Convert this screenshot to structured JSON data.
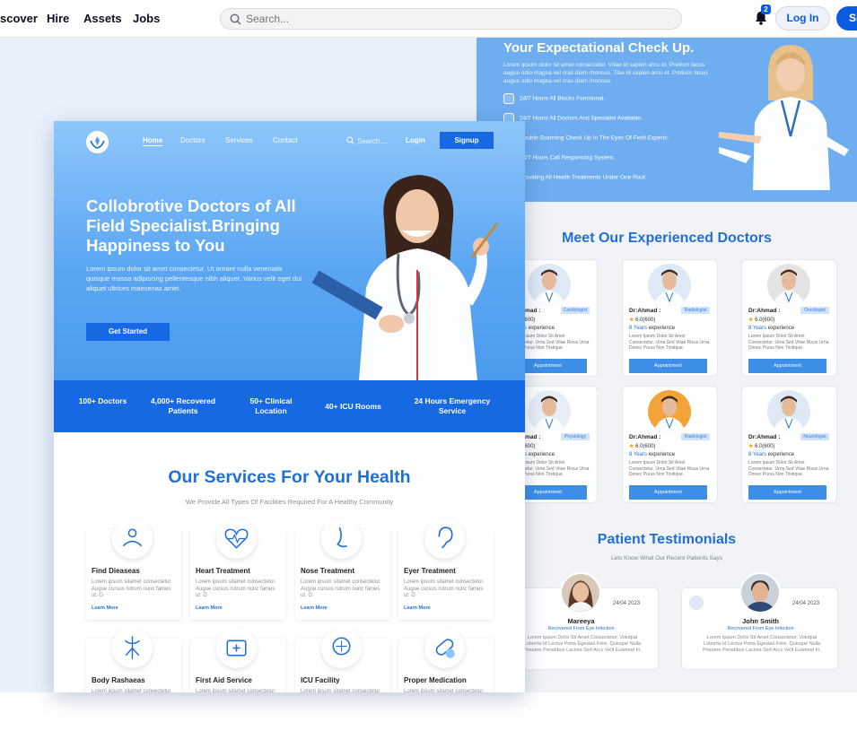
{
  "topnav": {
    "links": [
      "scover",
      "Hire",
      "Assets",
      "Jobs"
    ],
    "search_placeholder": "Search...",
    "notif_count": "2",
    "login": "Log In",
    "signup": "Si"
  },
  "right": {
    "hero_title": "Your Expectational Check Up.",
    "hero_text": "Lorem ipsum dolor sit amet consectetur. Vitae id sapien arcu et. Pretium lacus augue odio magna vel cras diam rhoncus. Tlae id sapien arcu et. Pretium lacus augue odio magna vel cras diam rhoncus.",
    "features": [
      "24/7 Hours All Blocks Functional.",
      "24/7 Hours All Doctors And Specialist Available.",
      "Double Scanning Check Up In The Eyes Of Field Experts.",
      "24/7 Hours Call Responcing System.",
      "Providing All Health Treatments Under One Roof."
    ],
    "doctors_title": "Meet Our Experienced Doctors",
    "doctors": [
      {
        "name": "Dr:Ahmad :",
        "spec": "Cardiologist",
        "rating": "6.0(600)",
        "exp": "8 Years",
        "exp_label": "experience",
        "desc": "Lorem Ipsum Dolor Sit Amet Consectetur. Urna Sed Vitae Risus Urna Donec Purus Non Tristique.",
        "button": "Appointment"
      },
      {
        "name": "Dr:Ahmad :",
        "spec": "Radiologist",
        "rating": "6.0(600)",
        "exp": "8 Years",
        "exp_label": "experience",
        "desc": "Lorem Ipsum Dolor Sit Amet Consectetur. Urna Sed Vitae Risus Urna Donec Purus Non Tristique.",
        "button": "Appointment"
      },
      {
        "name": "Dr:Ahmad :",
        "spec": "Oncologist",
        "rating": "6.0(600)",
        "exp": "8 Years",
        "exp_label": "experience",
        "desc": "Lorem Ipsum Dolor Sit Amet Consectetur. Urna Sed Vitae Risus Urna Donec Purus Non Tristique.",
        "button": "Appointment"
      },
      {
        "name": "Dr:Ahmad :",
        "spec": "Physiology",
        "rating": "6.0(600)",
        "exp": "8 Years",
        "exp_label": "experience",
        "desc": "Lorem Ipsum Dolor Sit Amet Consectetur. Urna Sed Vitae Risus Urna Donec Purus Non Tristique.",
        "button": "Appointment"
      },
      {
        "name": "Dr:Ahmad :",
        "spec": "Radiologist",
        "rating": "6.0(600)",
        "exp": "8 Years",
        "exp_label": "experience",
        "desc": "Lorem Ipsum Dolor Sit Amet Consectetur. Urna Sed Vitae Risus Urna Donec Purus Non Tristique.",
        "button": "Appointment"
      },
      {
        "name": "Dr:Ahmad :",
        "spec": "Neurologist",
        "rating": "6.0(600)",
        "exp": "8 Years",
        "exp_label": "experience",
        "desc": "Lorem Ipsum Dolor Sit Amet Consectetur. Urna Sed Vitae Risus Urna Donec Purus Non Tristique.",
        "button": "Appointment"
      }
    ],
    "testimonials_title": "Patient Testimonials",
    "testimonials_sub": "Lets Know What Our Recent Patients Says",
    "testimonials": [
      {
        "name": "Mareeya",
        "date": "24/04 2023",
        "recovered": "Recovered From Eye Infection",
        "text": "Lorem Ipsum Dolor Sit Amet Consectetur. Volutpat Lobortis Id Lectus Porta Egestas Felis. Quisque Nulla Posuere Penatibus Lacinia Sed Arcu Velit Euismod In."
      },
      {
        "name": "John Smith",
        "date": "24/04 2023",
        "recovered": "Recovered From Eye Infection",
        "text": "Lorem Ipsum Dolor Sit Amet Consectetur. Volutpat Lobortis Id Lectus Porta Egestas Felis. Quisque Nulla Posuere Penatibus Lacinia Sed Arcu Velit Euismod In."
      }
    ]
  },
  "left": {
    "nav": [
      "Home",
      "Doctors",
      "Services",
      "Contact"
    ],
    "search": "Search....",
    "login": "Login",
    "signup": "Signup",
    "hero_title": "Collobrotive Doctors of All Field Specialist.Bringing Happiness to You",
    "hero_text": "Lorem ipsum dolor sit amet consectetur. Ut ornare nulla venenatis quisque massa adipiscing pellentesque nibh aliquet. Varius velit eget dui aliquet ultrices maecenas amet.",
    "cta": "Get Started",
    "stats": [
      "100+ Doctors",
      "4,000+ Recovered Patients",
      "50+ Clinical Location",
      "40+ ICU Rooms",
      "24 Hours Emergency Service"
    ],
    "services_title": "Our Services For Your Health",
    "services_sub": "We Provide All Types Of Facilities Required For A Healthy Community",
    "services": [
      {
        "title": "Find Dieaseas",
        "text": "Lorem ipsum sitamet consectetur. Augue cursus rutrum  nunc fames ut. G",
        "more": "Learn More"
      },
      {
        "title": "Heart Treatment",
        "text": "Lorem ipsum sitamet consectetur. Augue cursus rutrum  nunc fames ut. G",
        "more": "Learn More"
      },
      {
        "title": "Nose Treatment",
        "text": "Lorem ipsum sitamet consectetur. Augue cursus rutrum  nunc fames ut. G",
        "more": "Learn More"
      },
      {
        "title": "Eyer Treatment",
        "text": "Lorem ipsum sitamet consectetur. Augue cursus rutrum  nunc fames ut. G",
        "more": "Learn More"
      },
      {
        "title": "Body Rashaeas",
        "text": "Lorem ipsum sitamet consectetur",
        "more": ""
      },
      {
        "title": "First Aid Service",
        "text": "Lorem ipsum sitamet consectetur",
        "more": ""
      },
      {
        "title": "ICU Facility",
        "text": "Lorem ipsum sitamet consectetur",
        "more": ""
      },
      {
        "title": "Proper Medication",
        "text": "Lorem ipsum sitamet consectetur",
        "more": ""
      }
    ]
  },
  "colors": {
    "primary": "#1669e3",
    "accent_blue": "#1f6fd6",
    "hero_light": "#8ec6fb"
  }
}
